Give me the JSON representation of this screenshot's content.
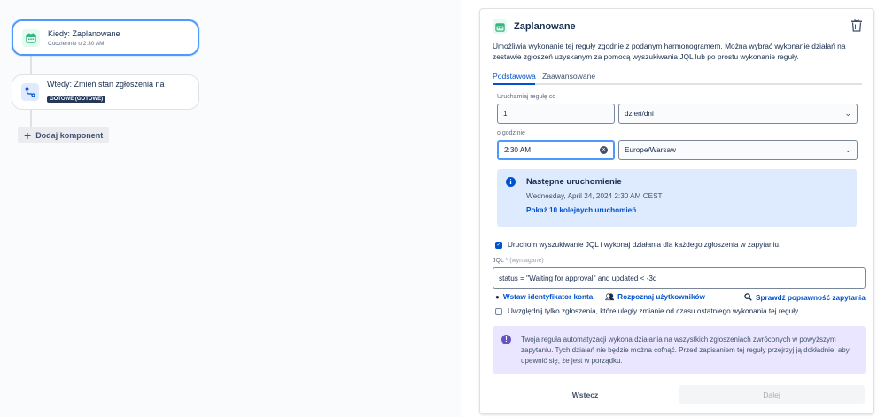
{
  "flow": {
    "trigger": {
      "title": "Kiedy: Zaplanowane",
      "subtitle": "Codziennie o 2:30 AM"
    },
    "action": {
      "title": "Wtedy: Zmień stan zgłoszenia na",
      "status_lozenge": "GOTOWE (GOTOWE)"
    },
    "add_component_label": "Dodaj komponent"
  },
  "panel": {
    "title": "Zaplanowane",
    "description": "Umożliwia wykonanie tej reguły zgodnie z podanym harmonogramem. Można wybrać wykonanie działań na zestawie zgłoszeń uzyskanym za pomocą wyszukiwania JQL lub po prostu wykonanie reguły.",
    "tabs": [
      {
        "label": "Podstawowa",
        "active": true
      },
      {
        "label": "Zaawansowane",
        "active": false
      }
    ],
    "run_every_label": "Uruchamiaj regułę co",
    "run_every_value": "1",
    "unit_value": "dzień/dni",
    "time_label": "o godzinie",
    "time_value": "2:30 AM",
    "timezone_value": "Europe/Warsaw",
    "next_run": {
      "heading": "Następne uruchomienie",
      "date": "Wednesday, April 24, 2024 2:30 AM CEST",
      "show_more_link": "Pokaż 10 kolejnych uruchomień"
    },
    "jql_checkbox": {
      "label": "Uruchom wyszukiwanie JQL i wykonaj działania dla każdego zgłoszenia w zapytaniu.",
      "checked": true
    },
    "jql_label": "JQL",
    "jql_required_mark": "*",
    "jql_required_text": "(wymagane)",
    "jql_value": "status = \"Waiting for approval\" and updated < -3d",
    "jql_actions": {
      "insert_account": "Wstaw identyfikator konta",
      "find_users": "Rozpoznaj użytkowników",
      "validate": "Sprawdź poprawność zapytania"
    },
    "changed_only_checkbox": {
      "label": "Uwzględnij tylko zgłoszenia, które uległy zmianie od czasu ostatniego wykonania tej reguły",
      "checked": false
    },
    "warning_text": "Twoja reguła automatyzacji wykona działania na wszystkich zgłoszeniach zwróconych w powyższym zapytaniu. Tych działań nie będzie można cofnąć. Przed zapisaniem tej reguły przejrzyj ją dokładnie, aby upewnić się, że jest w porządku.",
    "back_button": "Wstecz",
    "next_button": "Dalej"
  },
  "colors": {
    "accent": "#0052cc",
    "focus": "#4c9aff",
    "info_bg": "#deebff",
    "warning_bg": "#eae6ff",
    "trigger_icon_green": "#36b37e"
  },
  "icons": {
    "trigger": "calendar-icon",
    "action": "transition-icon",
    "delete": "trash-icon",
    "info": "info-icon",
    "account": "user-icon",
    "users": "users-icon",
    "validate": "search-icon"
  }
}
